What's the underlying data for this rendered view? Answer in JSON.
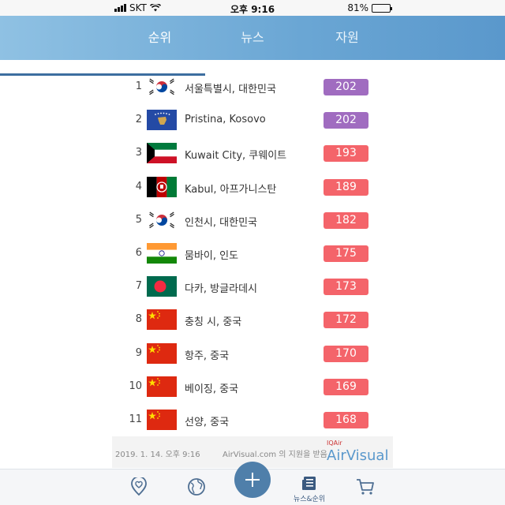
{
  "status_bar": {
    "carrier": "SKT",
    "time": "오후 9:16",
    "battery": "81%",
    "battery_level": 0.81
  },
  "tabs": [
    {
      "label": "순위",
      "active": true
    },
    {
      "label": "뉴스",
      "active": false
    },
    {
      "label": "자원",
      "active": false
    }
  ],
  "colors": {
    "header_gradient_start": "#8fc1e3",
    "header_gradient_end": "#5a98cc",
    "aqi_purple": "#a06cc0",
    "aqi_red": "#f4646a",
    "accent": "#4f7faa"
  },
  "rankings": [
    {
      "rank": "1",
      "city": "서울특별시, 대한민국",
      "aqi": "202",
      "level": "purple",
      "flag": "south-korea"
    },
    {
      "rank": "2",
      "city": "Pristina, Kosovo",
      "aqi": "202",
      "level": "purple",
      "flag": "kosovo"
    },
    {
      "rank": "3",
      "city": "Kuwait City, 쿠웨이트",
      "aqi": "193",
      "level": "red",
      "flag": "kuwait"
    },
    {
      "rank": "4",
      "city": "Kabul, 아프가니스탄",
      "aqi": "189",
      "level": "red",
      "flag": "afghanistan"
    },
    {
      "rank": "5",
      "city": "인천시, 대한민국",
      "aqi": "182",
      "level": "red",
      "flag": "south-korea"
    },
    {
      "rank": "6",
      "city": "뭄바이, 인도",
      "aqi": "175",
      "level": "red",
      "flag": "india"
    },
    {
      "rank": "7",
      "city": "다카, 방글라데시",
      "aqi": "173",
      "level": "red",
      "flag": "bangladesh"
    },
    {
      "rank": "8",
      "city": "충칭 시, 중국",
      "aqi": "172",
      "level": "red",
      "flag": "china"
    },
    {
      "rank": "9",
      "city": "항주, 중국",
      "aqi": "170",
      "level": "red",
      "flag": "china"
    },
    {
      "rank": "10",
      "city": "베이징, 중국",
      "aqi": "169",
      "level": "red",
      "flag": "china"
    },
    {
      "rank": "11",
      "city": "선양, 중국",
      "aqi": "168",
      "level": "red",
      "flag": "china"
    }
  ],
  "footer": {
    "date": "2019. 1. 14. 오후 9:16",
    "credit": "AirVisual.com 의 지원을 받음",
    "brand_small": "IQAir",
    "brand": "AirVisual"
  },
  "bottom_nav": [
    {
      "icon": "heart-location-icon",
      "label": ""
    },
    {
      "icon": "globe-icon",
      "label": ""
    },
    {
      "icon": "plus-icon",
      "label": ""
    },
    {
      "icon": "news-icon",
      "label": "뉴스&순위"
    },
    {
      "icon": "cart-icon",
      "label": ""
    }
  ]
}
